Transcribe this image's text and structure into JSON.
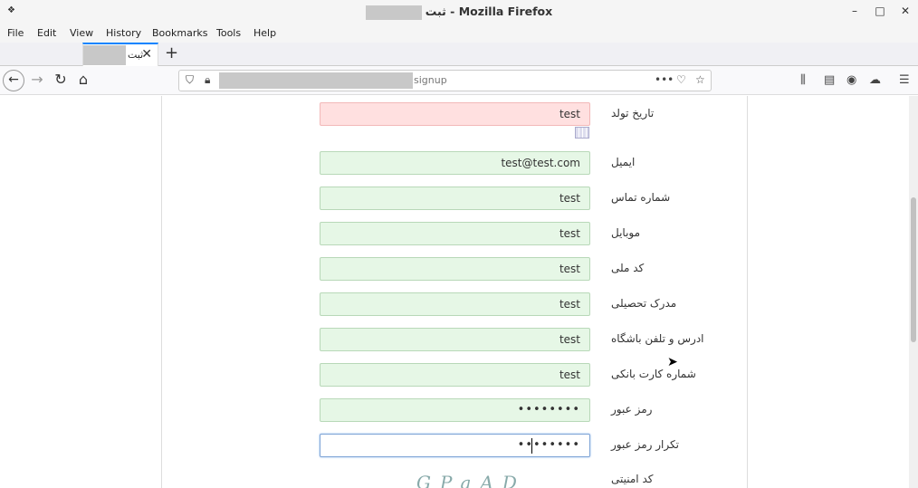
{
  "window": {
    "title_suffix": "ثبت - Mozilla Firefox",
    "minimize": "–",
    "maximize": "□",
    "close": "✕"
  },
  "menu": [
    "File",
    "Edit",
    "View",
    "History",
    "Bookmarks",
    "Tools",
    "Help"
  ],
  "tab": {
    "label": "ثبت",
    "close": "✕",
    "new_tab": "+"
  },
  "url": {
    "path": "signup"
  },
  "form": {
    "birth_date": {
      "label": "تاریخ تولد",
      "value": "test"
    },
    "email": {
      "label": "ایمیل",
      "value": "test@test.com"
    },
    "phone": {
      "label": "شماره تماس",
      "value": "test"
    },
    "mobile": {
      "label": "موبایل",
      "value": "test"
    },
    "national_code": {
      "label": "کد ملی",
      "value": "test"
    },
    "education": {
      "label": "مدرک تحصیلی",
      "value": "test"
    },
    "club_address": {
      "label": "ادرس و تلفن باشگاه",
      "value": "test"
    },
    "bank_card": {
      "label": "شماره کارت بانکی",
      "value": "test"
    },
    "password": {
      "label": "رمز عبور",
      "value": "••••••••"
    },
    "password_confirm": {
      "label": "تکرار رمز عبور",
      "value": "••••••••"
    },
    "captcha": {
      "label": "کد امنیتی",
      "text": "GPaAD"
    }
  },
  "colors": {
    "valid_bg": "#e6f7e6",
    "error_bg": "#ffe0e0",
    "tab_accent": "#0a84ff"
  }
}
